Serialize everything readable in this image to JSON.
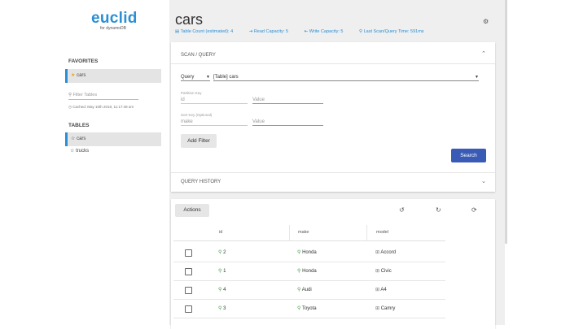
{
  "brand": {
    "name": "euclid",
    "subtitle": "for dynamoDB"
  },
  "sidebar": {
    "favorites_heading": "FAVORITES",
    "favorites": [
      {
        "label": "cars",
        "icon": "star-filled-icon"
      }
    ],
    "filter_placeholder": "Filter Tables",
    "cached_text": "Cached: May 10th 2018, 11:17:48 am",
    "tables_heading": "TABLES",
    "tables": [
      {
        "label": "cars",
        "icon": "star-outline-icon",
        "active": true
      },
      {
        "label": "trucks",
        "icon": "star-outline-icon",
        "active": false
      }
    ]
  },
  "header": {
    "title": "cars",
    "stats": {
      "table_count": "Table Count (estimated): 4",
      "read_capacity": "Read Capacity: 5",
      "write_capacity": "Write Capacity: 5",
      "last_scan": "Last Scan/Query Time: 591ms"
    }
  },
  "query_panel": {
    "heading": "SCAN / QUERY",
    "mode": "Query",
    "index": "[Table] cars",
    "partition_key_label": "Partition Key",
    "partition_key_name": "id",
    "partition_value_placeholder": "Value",
    "sort_key_label": "Sort Key (Optional)",
    "sort_key_name": "make",
    "sort_value_placeholder": "Value",
    "add_filter": "Add Filter",
    "search": "Search",
    "history_heading": "QUERY HISTORY"
  },
  "results": {
    "actions": "Actions",
    "columns": [
      "id",
      "make",
      "model"
    ],
    "rows": [
      {
        "id": "2",
        "make": "Honda",
        "model": "Accord"
      },
      {
        "id": "1",
        "make": "Honda",
        "model": "Civic"
      },
      {
        "id": "4",
        "make": "Audi",
        "model": "A4"
      },
      {
        "id": "3",
        "make": "Toyota",
        "model": "Camry"
      }
    ]
  },
  "colors": {
    "accent": "#2a8fd4",
    "primary_button": "#3a5bb5",
    "search_icon": "#3b9a3b"
  }
}
